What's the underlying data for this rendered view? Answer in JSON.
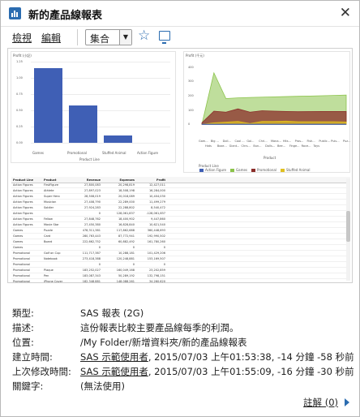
{
  "window": {
    "title": "新的產品線報表",
    "close_glyph": "✕"
  },
  "toolbar": {
    "view_label": "檢視",
    "edit_label": "編輯",
    "select_value": "集合",
    "select_arrow": "▼",
    "favorite_glyph": "☆"
  },
  "preview": {
    "left_chart": {
      "title": "Profit (小記)",
      "ytick": [
        "1.25",
        "1.00",
        "0.75",
        "0.50",
        "0.25",
        "0.00"
      ],
      "xlabel": "Product Line"
    },
    "right_chart": {
      "title": "Profit (千元)",
      "ytick": [
        "400",
        "300",
        "200",
        "100",
        "0"
      ],
      "xlabel": "Product",
      "xticks": [
        "Gam...",
        "Big ...",
        "Doll...",
        "Cool ...",
        "Gol...",
        "Chri...",
        "Mana...",
        "Hits...",
        "Pros...",
        "Fish...",
        "Public...",
        "Puis...",
        "Puz..."
      ],
      "xticks2": [
        "Hats",
        "Boxe...",
        "Giant...",
        "Chrs...",
        "Bun...",
        "Dolls...",
        "Bee...",
        "Finge...",
        "Roce...",
        "Toys"
      ],
      "legend_title": "Product Line"
    },
    "table": {
      "columns": [
        "Product Line",
        "Product",
        "Revenue",
        "Expenses",
        "Profit"
      ],
      "rows": [
        [
          "Action Figures",
          "FirstFigure",
          "27,800,083",
          "20,298,819",
          "12,427,011"
        ],
        [
          "Action Figures",
          "Athlete",
          "27,897,023",
          "18,508,198",
          "16,284,000"
        ],
        [
          "Action Figures",
          "Super Hero",
          "28,508,019",
          "20,018,089",
          "10,404,030"
        ],
        [
          "Action Figures",
          "Musician",
          "27,408,790",
          "22,289,000",
          "11,499,279"
        ],
        [
          "Action Figures",
          "Soldier",
          "27,924,283",
          "22,288,802",
          "8,540,472"
        ],
        [
          "Action Figures",
          "",
          "0",
          "128,061,837",
          "-128,061,837"
        ],
        [
          "Action Figures",
          "Fellow",
          "27,848,762",
          "18,400,902",
          "9,447,860"
        ],
        [
          "Action Figures",
          "Movie Star",
          "27,450,380",
          "16,828,840",
          "10,621,540"
        ],
        [
          "Games",
          "Puzzle",
          "478,311,381",
          "117,862,688",
          "360,448,693"
        ],
        [
          "Games",
          "Card",
          "280,763,443",
          "87,772,941",
          "192,990,502"
        ],
        [
          "Games",
          "Board",
          "222,662,752",
          "60,882,492",
          "161,780,260"
        ],
        [
          "Games",
          "",
          "0",
          "0",
          "0"
        ],
        [
          "Promotional",
          "Golf on Cup",
          "111,717,387",
          "10,288,181",
          "101,429,206"
        ],
        [
          "Promotional",
          "Notebook",
          "273,418,388",
          "120,248,881",
          "153,169,507"
        ],
        [
          "Promotional",
          "",
          "0",
          "0",
          "0"
        ],
        [
          "Promotional",
          "Plaque",
          "183,252,027",
          "160,049,168",
          "23,202,859"
        ],
        [
          "Promotional",
          "Pen",
          "183,087,343",
          "50,289,192",
          "132,798,151"
        ],
        [
          "Promotional",
          "iPhone Cover",
          "182,348,881",
          "148,088,261",
          "34,260,620"
        ]
      ]
    }
  },
  "chart_data": [
    {
      "type": "bar",
      "title": "Profit (小記)",
      "xlabel": "Product Line",
      "ylabel": "",
      "categories": [
        "Games",
        "Promotional",
        "Stuffed Animal",
        "Action Figure"
      ],
      "values": [
        1.15,
        0.58,
        0.11,
        0.0
      ],
      "ylim": [
        0,
        1.25
      ],
      "grid": true
    },
    {
      "type": "area",
      "title": "Profit (千元)",
      "xlabel": "Product",
      "legend_title": "Product Line",
      "legend_position": "bottom",
      "series": [
        {
          "name": "Action Figure",
          "color": "#3f5fb5",
          "values": [
            0,
            0,
            0,
            0,
            0,
            0,
            0,
            0,
            0,
            0,
            0,
            0,
            0
          ]
        },
        {
          "name": "Games",
          "color": "#8bc34a",
          "values": [
            0,
            360,
            180,
            185,
            188,
            190,
            192,
            194,
            196,
            198,
            200,
            202,
            205
          ]
        },
        {
          "name": "Promotional",
          "color": "#8b2e2a",
          "values": [
            10,
            92,
            85,
            108,
            85,
            95,
            92,
            90,
            88,
            89,
            90,
            90,
            90
          ]
        },
        {
          "name": "Stuffed Animal",
          "color": "#e0c020",
          "values": [
            0,
            10,
            15,
            20,
            5,
            20,
            20,
            22,
            18,
            18,
            18,
            18,
            16
          ]
        }
      ],
      "ylim": [
        -50,
        450
      ]
    }
  ],
  "details": {
    "type_label": "類型:",
    "type_value": "SAS 報表 (2G)",
    "desc_label": "描述:",
    "desc_value": "這份報表比較主要產品線每季的利潤。",
    "location_label": "位置:",
    "location_value": "/My Folder/新增資料夾/新的產品線報表",
    "created_label": "建立時間:",
    "created_user": "SAS 示範使用者",
    "created_rest": ", 2015/07/03 上午01:53:38, -14 分鐘 -58 秒前",
    "modified_label": "上次修改時間:",
    "modified_user": "SAS 示範使用者",
    "modified_rest": ", 2015/07/03 上午01:55:09, -16 分鐘 -30 秒前",
    "keywords_label": "關鍵字:",
    "keywords_value": "(無法使用)",
    "comments_link": "註解 (0)"
  }
}
